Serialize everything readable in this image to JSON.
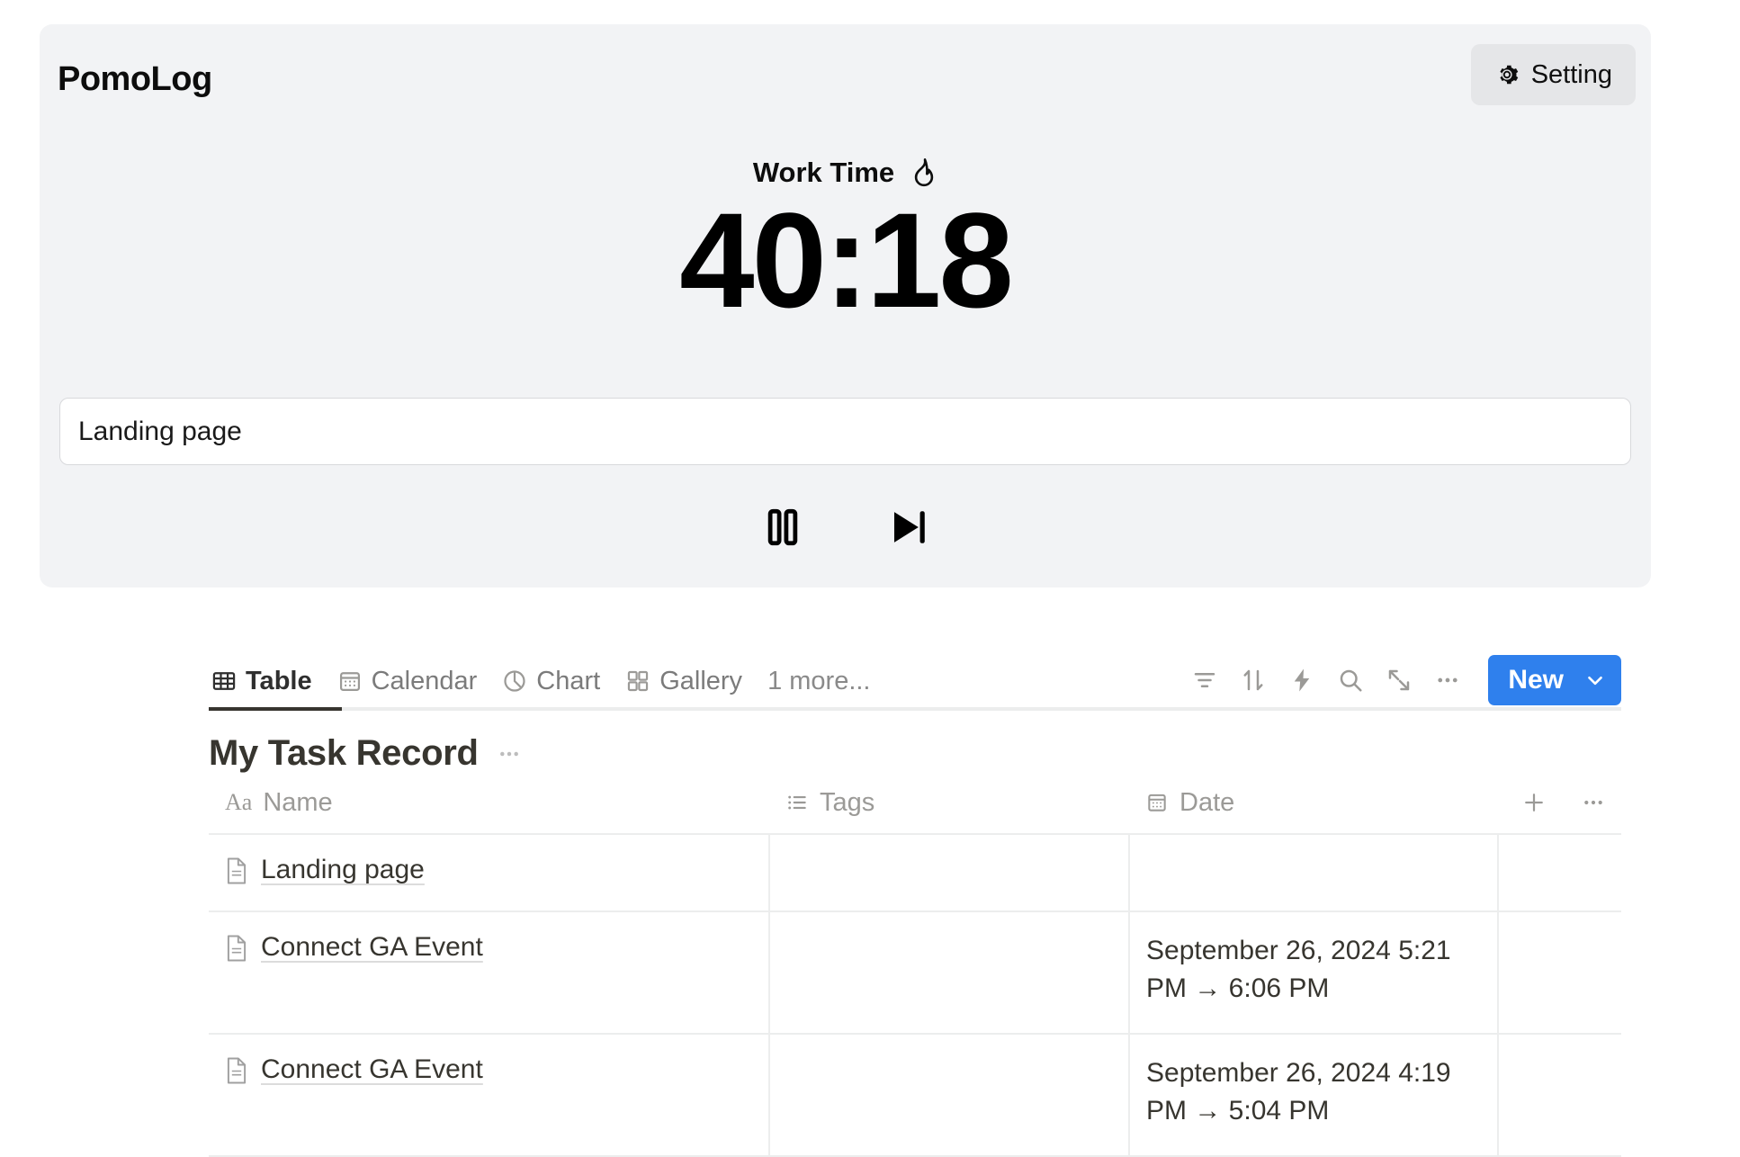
{
  "app": {
    "title": "PomoLog"
  },
  "header": {
    "setting_label": "Setting",
    "gear_icon": "gear-icon"
  },
  "timer": {
    "mode_label": "Work Time",
    "mode_icon": "flame-icon",
    "display": "40:18",
    "task_value": "Landing page",
    "task_placeholder": "",
    "controls": [
      {
        "name": "pause-button",
        "icon": "pause-icon"
      },
      {
        "name": "skip-button",
        "icon": "skip-next-icon"
      }
    ]
  },
  "database": {
    "views": [
      {
        "label": "Table",
        "icon": "table-icon",
        "active": true
      },
      {
        "label": "Calendar",
        "icon": "calendar-icon",
        "active": false
      },
      {
        "label": "Chart",
        "icon": "chart-icon",
        "active": false
      },
      {
        "label": "Gallery",
        "icon": "gallery-icon",
        "active": false
      }
    ],
    "more_views_label": "1 more...",
    "toolbar": [
      {
        "name": "filter-button",
        "icon": "filter-icon"
      },
      {
        "name": "sort-button",
        "icon": "sort-icon"
      },
      {
        "name": "automation-button",
        "icon": "lightning-icon"
      },
      {
        "name": "search-button",
        "icon": "search-icon"
      },
      {
        "name": "expand-button",
        "icon": "expand-icon"
      },
      {
        "name": "more-options-button",
        "icon": "ellipsis-icon"
      }
    ],
    "new_button": {
      "label": "New",
      "chevron_icon": "chevron-down-icon",
      "color": "#2f80ed"
    },
    "title": "My Task Record",
    "title_menu_icon": "ellipsis-icon",
    "columns": [
      {
        "label": "Name",
        "icon": "aa-text-icon"
      },
      {
        "label": "Tags",
        "icon": "list-icon"
      },
      {
        "label": "Date",
        "icon": "calendar-icon"
      }
    ],
    "header_actions": [
      {
        "name": "add-column-button",
        "icon": "plus-icon"
      },
      {
        "name": "column-options-button",
        "icon": "ellipsis-icon"
      }
    ],
    "rows": [
      {
        "name": "Landing page",
        "tags": "",
        "date": ""
      },
      {
        "name": "Connect GA Event",
        "tags": "",
        "date": "September 26, 2024 5:21 PM → 6:06 PM"
      },
      {
        "name": "Connect GA Event",
        "tags": "",
        "date": "September 26, 2024 4:19 PM → 5:04 PM"
      }
    ]
  },
  "colors": {
    "card_bg": "#f2f3f5",
    "accent": "#2f80ed",
    "text": "#37352f",
    "muted": "#9b9a97",
    "border": "#eceded"
  }
}
